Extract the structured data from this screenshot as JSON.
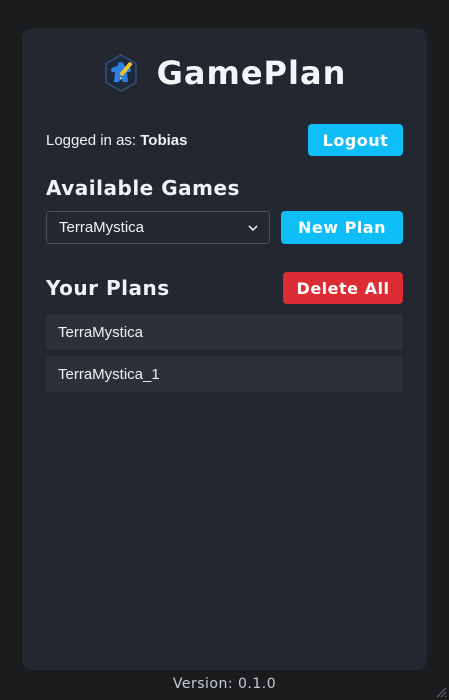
{
  "app": {
    "title": "GamePlan",
    "logo_icon": "meeple-hexagon-icon"
  },
  "session": {
    "logged_in_prefix": "Logged in as: ",
    "username": "Tobias",
    "logout_label": "Logout"
  },
  "games": {
    "section_title": "Available Games",
    "selected": "TerraMystica",
    "new_plan_label": "New Plan"
  },
  "plans": {
    "section_title": "Your Plans",
    "delete_all_label": "Delete All",
    "items": [
      "TerraMystica",
      "TerraMystica_1"
    ]
  },
  "footer": {
    "version": "Version: 0.1.0"
  },
  "colors": {
    "background": "#1b1c1e",
    "panel": "#222730",
    "accent": "#0fbef7",
    "danger": "#dc2d35",
    "list_item": "#2c3038"
  }
}
